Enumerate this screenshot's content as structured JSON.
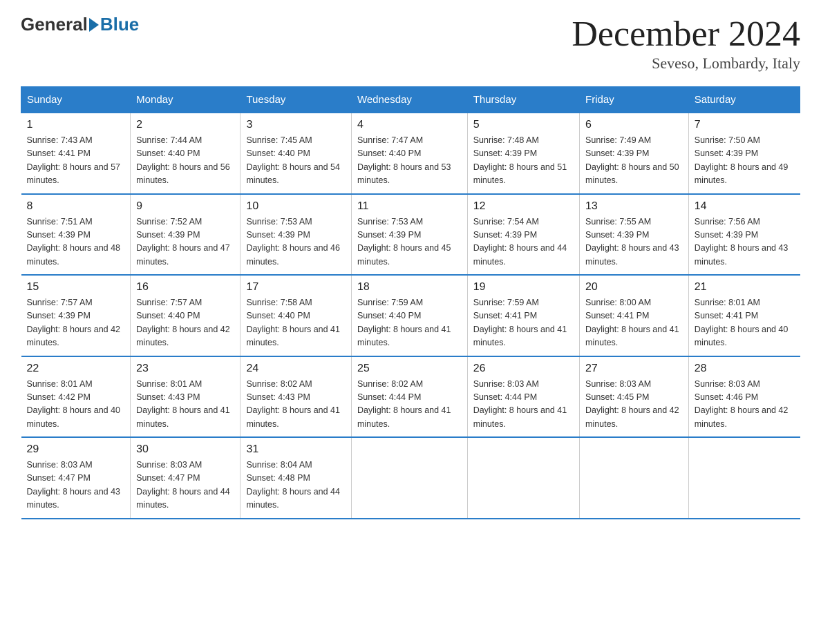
{
  "header": {
    "logo": {
      "general": "General",
      "blue": "Blue"
    },
    "title": "December 2024",
    "subtitle": "Seveso, Lombardy, Italy"
  },
  "days_header": [
    "Sunday",
    "Monday",
    "Tuesday",
    "Wednesday",
    "Thursday",
    "Friday",
    "Saturday"
  ],
  "weeks": [
    [
      {
        "day": "1",
        "sunrise": "7:43 AM",
        "sunset": "4:41 PM",
        "daylight": "8 hours and 57 minutes."
      },
      {
        "day": "2",
        "sunrise": "7:44 AM",
        "sunset": "4:40 PM",
        "daylight": "8 hours and 56 minutes."
      },
      {
        "day": "3",
        "sunrise": "7:45 AM",
        "sunset": "4:40 PM",
        "daylight": "8 hours and 54 minutes."
      },
      {
        "day": "4",
        "sunrise": "7:47 AM",
        "sunset": "4:40 PM",
        "daylight": "8 hours and 53 minutes."
      },
      {
        "day": "5",
        "sunrise": "7:48 AM",
        "sunset": "4:39 PM",
        "daylight": "8 hours and 51 minutes."
      },
      {
        "day": "6",
        "sunrise": "7:49 AM",
        "sunset": "4:39 PM",
        "daylight": "8 hours and 50 minutes."
      },
      {
        "day": "7",
        "sunrise": "7:50 AM",
        "sunset": "4:39 PM",
        "daylight": "8 hours and 49 minutes."
      }
    ],
    [
      {
        "day": "8",
        "sunrise": "7:51 AM",
        "sunset": "4:39 PM",
        "daylight": "8 hours and 48 minutes."
      },
      {
        "day": "9",
        "sunrise": "7:52 AM",
        "sunset": "4:39 PM",
        "daylight": "8 hours and 47 minutes."
      },
      {
        "day": "10",
        "sunrise": "7:53 AM",
        "sunset": "4:39 PM",
        "daylight": "8 hours and 46 minutes."
      },
      {
        "day": "11",
        "sunrise": "7:53 AM",
        "sunset": "4:39 PM",
        "daylight": "8 hours and 45 minutes."
      },
      {
        "day": "12",
        "sunrise": "7:54 AM",
        "sunset": "4:39 PM",
        "daylight": "8 hours and 44 minutes."
      },
      {
        "day": "13",
        "sunrise": "7:55 AM",
        "sunset": "4:39 PM",
        "daylight": "8 hours and 43 minutes."
      },
      {
        "day": "14",
        "sunrise": "7:56 AM",
        "sunset": "4:39 PM",
        "daylight": "8 hours and 43 minutes."
      }
    ],
    [
      {
        "day": "15",
        "sunrise": "7:57 AM",
        "sunset": "4:39 PM",
        "daylight": "8 hours and 42 minutes."
      },
      {
        "day": "16",
        "sunrise": "7:57 AM",
        "sunset": "4:40 PM",
        "daylight": "8 hours and 42 minutes."
      },
      {
        "day": "17",
        "sunrise": "7:58 AM",
        "sunset": "4:40 PM",
        "daylight": "8 hours and 41 minutes."
      },
      {
        "day": "18",
        "sunrise": "7:59 AM",
        "sunset": "4:40 PM",
        "daylight": "8 hours and 41 minutes."
      },
      {
        "day": "19",
        "sunrise": "7:59 AM",
        "sunset": "4:41 PM",
        "daylight": "8 hours and 41 minutes."
      },
      {
        "day": "20",
        "sunrise": "8:00 AM",
        "sunset": "4:41 PM",
        "daylight": "8 hours and 41 minutes."
      },
      {
        "day": "21",
        "sunrise": "8:01 AM",
        "sunset": "4:41 PM",
        "daylight": "8 hours and 40 minutes."
      }
    ],
    [
      {
        "day": "22",
        "sunrise": "8:01 AM",
        "sunset": "4:42 PM",
        "daylight": "8 hours and 40 minutes."
      },
      {
        "day": "23",
        "sunrise": "8:01 AM",
        "sunset": "4:43 PM",
        "daylight": "8 hours and 41 minutes."
      },
      {
        "day": "24",
        "sunrise": "8:02 AM",
        "sunset": "4:43 PM",
        "daylight": "8 hours and 41 minutes."
      },
      {
        "day": "25",
        "sunrise": "8:02 AM",
        "sunset": "4:44 PM",
        "daylight": "8 hours and 41 minutes."
      },
      {
        "day": "26",
        "sunrise": "8:03 AM",
        "sunset": "4:44 PM",
        "daylight": "8 hours and 41 minutes."
      },
      {
        "day": "27",
        "sunrise": "8:03 AM",
        "sunset": "4:45 PM",
        "daylight": "8 hours and 42 minutes."
      },
      {
        "day": "28",
        "sunrise": "8:03 AM",
        "sunset": "4:46 PM",
        "daylight": "8 hours and 42 minutes."
      }
    ],
    [
      {
        "day": "29",
        "sunrise": "8:03 AM",
        "sunset": "4:47 PM",
        "daylight": "8 hours and 43 minutes."
      },
      {
        "day": "30",
        "sunrise": "8:03 AM",
        "sunset": "4:47 PM",
        "daylight": "8 hours and 44 minutes."
      },
      {
        "day": "31",
        "sunrise": "8:04 AM",
        "sunset": "4:48 PM",
        "daylight": "8 hours and 44 minutes."
      },
      null,
      null,
      null,
      null
    ]
  ]
}
